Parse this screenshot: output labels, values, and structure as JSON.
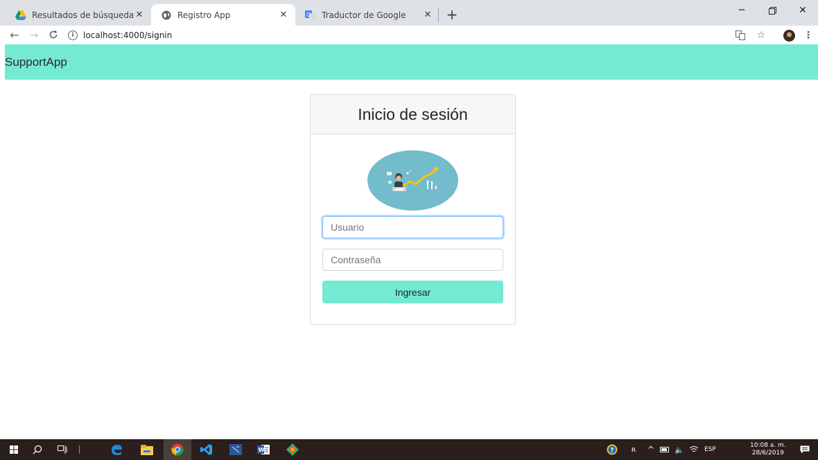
{
  "browser": {
    "tabs": [
      {
        "title": "Resultados de búsqueda - Googl",
        "icon": "google-drive-icon"
      },
      {
        "title": "Registro App",
        "icon": "globe-icon",
        "active": true
      },
      {
        "title": "Traductor de Google",
        "icon": "google-translate-icon"
      }
    ],
    "url": "localhost:4000/signin"
  },
  "navbar": {
    "brand": "SupportApp",
    "color": "#74ead3"
  },
  "login": {
    "title": "Inicio de sesión",
    "username_placeholder": "Usuario",
    "password_placeholder": "Contraseña",
    "submit_label": "Ingresar"
  },
  "taskbar": {
    "language": "ESP",
    "time": "10:08 a. m.",
    "date": "28/6/2019"
  }
}
